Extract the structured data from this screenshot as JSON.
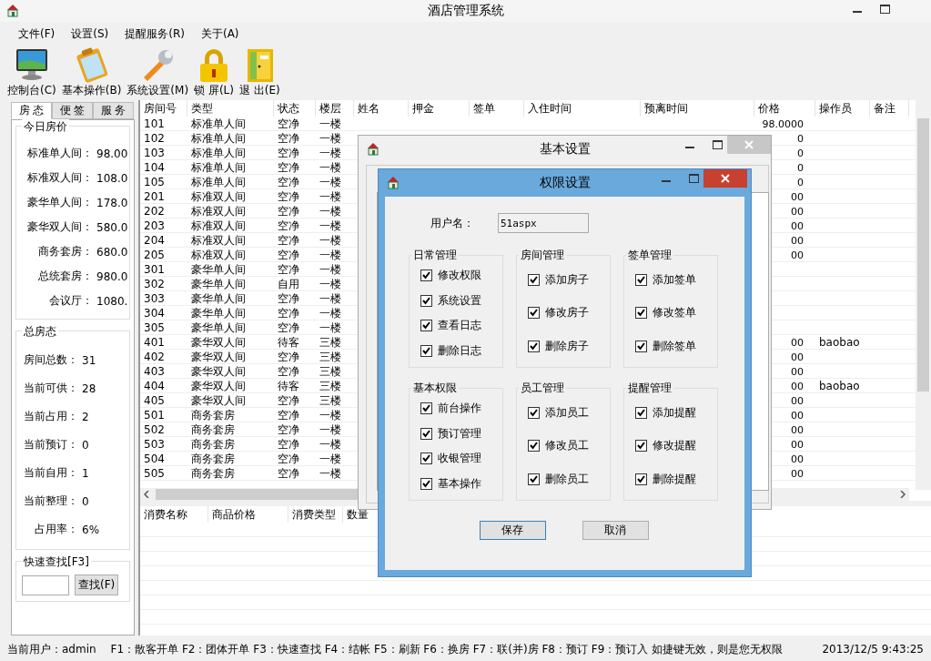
{
  "window": {
    "title": "酒店管理系统"
  },
  "menu": [
    "文件(F)",
    "设置(S)",
    "提醒服务(R)",
    "关于(A)"
  ],
  "toolbar": [
    {
      "kind": "monitor",
      "label": "控制台(C)"
    },
    {
      "kind": "clipboard",
      "label": "基本操作(B)"
    },
    {
      "kind": "wrench",
      "label": "系统设置(M)"
    },
    {
      "kind": "padlock",
      "label": "锁 屏(L)"
    },
    {
      "kind": "door",
      "label": "退 出(E)"
    }
  ],
  "side_tabs": [
    {
      "label": "房 态",
      "selected": true
    },
    {
      "label": "便 签",
      "selected": false
    },
    {
      "label": "服 务",
      "selected": false
    }
  ],
  "today_prices": {
    "title": "今日房价",
    "rows": [
      {
        "label": "标准单人间：",
        "value": "98.00"
      },
      {
        "label": "标准双人间：",
        "value": "108.0"
      },
      {
        "label": "豪华单人间：",
        "value": "178.0"
      },
      {
        "label": "豪华双人间：",
        "value": "580.0"
      },
      {
        "label": "商务套房：",
        "value": "680.0"
      },
      {
        "label": "总统套房：",
        "value": "980.0"
      },
      {
        "label": "会议厅：",
        "value": "1080."
      }
    ]
  },
  "room_summary": {
    "title": "总房态",
    "rows": [
      {
        "label": "房间总数：",
        "value": "31"
      },
      {
        "label": "当前可供：",
        "value": "28"
      },
      {
        "label": "当前占用：",
        "value": "2"
      },
      {
        "label": "当前预订：",
        "value": "0"
      },
      {
        "label": "当前自用：",
        "value": "1"
      },
      {
        "label": "当前整理：",
        "value": "0"
      },
      {
        "label": "占用率：",
        "value": "6%"
      }
    ]
  },
  "quick_search": {
    "title": "快速查找[F3]",
    "button": "查找(F)"
  },
  "rooms_table": {
    "columns": [
      "房间号",
      "类型",
      "状态",
      "楼层",
      "姓名",
      "押金",
      "签单",
      "入住时间",
      "预离时间",
      "价格",
      "操作员",
      "备注"
    ],
    "rows": [
      {
        "room": "101",
        "type": "标准单人间",
        "status": "空净",
        "floor": "一楼",
        "price": "98.0000"
      },
      {
        "room": "102",
        "type": "标准单人间",
        "status": "空净",
        "floor": "一楼",
        "price": "0"
      },
      {
        "room": "103",
        "type": "标准单人间",
        "status": "空净",
        "floor": "一楼",
        "price": "0"
      },
      {
        "room": "104",
        "type": "标准单人间",
        "status": "空净",
        "floor": "一楼",
        "price": "0"
      },
      {
        "room": "105",
        "type": "标准单人间",
        "status": "空净",
        "floor": "一楼",
        "price": "0"
      },
      {
        "room": "201",
        "type": "标准双人间",
        "status": "空净",
        "floor": "一楼",
        "price": "00"
      },
      {
        "room": "202",
        "type": "标准双人间",
        "status": "空净",
        "floor": "一楼",
        "price": "00"
      },
      {
        "room": "203",
        "type": "标准双人间",
        "status": "空净",
        "floor": "一楼",
        "price": "00"
      },
      {
        "room": "204",
        "type": "标准双人间",
        "status": "空净",
        "floor": "一楼",
        "price": "00"
      },
      {
        "room": "205",
        "type": "标准双人间",
        "status": "空净",
        "floor": "一楼",
        "price": "00"
      },
      {
        "room": "301",
        "type": "豪华单人间",
        "status": "空净",
        "floor": "一楼"
      },
      {
        "room": "302",
        "type": "豪华单人间",
        "status": "自用",
        "floor": "一楼"
      },
      {
        "room": "303",
        "type": "豪华单人间",
        "status": "空净",
        "floor": "一楼"
      },
      {
        "room": "304",
        "type": "豪华单人间",
        "status": "空净",
        "floor": "一楼"
      },
      {
        "room": "305",
        "type": "豪华单人间",
        "status": "空净",
        "floor": "一楼"
      },
      {
        "room": "401",
        "type": "豪华双人间",
        "status": "待客",
        "floor": "三楼",
        "price": "00",
        "operator": "baobao"
      },
      {
        "room": "402",
        "type": "豪华双人间",
        "status": "空净",
        "floor": "三楼",
        "price": "00"
      },
      {
        "room": "403",
        "type": "豪华双人间",
        "status": "空净",
        "floor": "三楼",
        "price": "00"
      },
      {
        "room": "404",
        "type": "豪华双人间",
        "status": "待客",
        "floor": "三楼",
        "price": "00",
        "operator": "baobao"
      },
      {
        "room": "405",
        "type": "豪华双人间",
        "status": "空净",
        "floor": "三楼",
        "price": "00"
      },
      {
        "room": "501",
        "type": "商务套房",
        "status": "空净",
        "floor": "一楼",
        "price": "00"
      },
      {
        "room": "502",
        "type": "商务套房",
        "status": "空净",
        "floor": "一楼",
        "price": "00"
      },
      {
        "room": "503",
        "type": "商务套房",
        "status": "空净",
        "floor": "一楼",
        "price": "00"
      },
      {
        "room": "504",
        "type": "商务套房",
        "status": "空净",
        "floor": "一楼",
        "price": "00"
      },
      {
        "room": "505",
        "type": "商务套房",
        "status": "空净",
        "floor": "一楼",
        "price": "00"
      }
    ]
  },
  "consumption_table": {
    "columns": [
      "消费名称",
      "商品价格",
      "消费类型",
      "数量"
    ]
  },
  "basic_settings_dialog": {
    "title": "基本设置"
  },
  "permission_dialog": {
    "title": "权限设置",
    "username_label": "用户名：",
    "username": "51aspx",
    "groups": [
      {
        "title": "日常管理",
        "items": [
          {
            "label": "修改权限",
            "checked": true
          },
          {
            "label": "系统设置",
            "checked": true
          },
          {
            "label": "查看日志",
            "checked": true
          },
          {
            "label": "删除日志",
            "checked": true
          }
        ]
      },
      {
        "title": "房间管理",
        "items": [
          {
            "label": "添加房子",
            "checked": true
          },
          {
            "label": "修改房子",
            "checked": true
          },
          {
            "label": "删除房子",
            "checked": true
          }
        ]
      },
      {
        "title": "签单管理",
        "items": [
          {
            "label": "添加签单",
            "checked": true
          },
          {
            "label": "修改签单",
            "checked": true
          },
          {
            "label": "删除签单",
            "checked": true
          }
        ]
      },
      {
        "title": "基本权限",
        "items": [
          {
            "label": "前台操作",
            "checked": true
          },
          {
            "label": "预订管理",
            "checked": true
          },
          {
            "label": "收银管理",
            "checked": true
          },
          {
            "label": "基本操作",
            "checked": true
          }
        ]
      },
      {
        "title": "员工管理",
        "items": [
          {
            "label": "添加员工",
            "checked": true
          },
          {
            "label": "修改员工",
            "checked": true
          },
          {
            "label": "删除员工",
            "checked": true
          }
        ]
      },
      {
        "title": "提醒管理",
        "items": [
          {
            "label": "添加提醒",
            "checked": true
          },
          {
            "label": "修改提醒",
            "checked": true
          },
          {
            "label": "删除提醒",
            "checked": true
          }
        ]
      }
    ],
    "buttons": [
      {
        "label": "保存",
        "default": true
      },
      {
        "label": "取消",
        "default": false
      }
    ]
  },
  "status_bar": {
    "user": "当前用户：admin",
    "shortcuts": "F1：散客开单 F2：团体开单 F3：快速查找 F4：结帐  F5：刷新  F6：换房  F7：联(并)房  F8：预订 F9：预订入  如捷键无效，则是您无权限",
    "time": "2013/12/5 9:43:25"
  }
}
